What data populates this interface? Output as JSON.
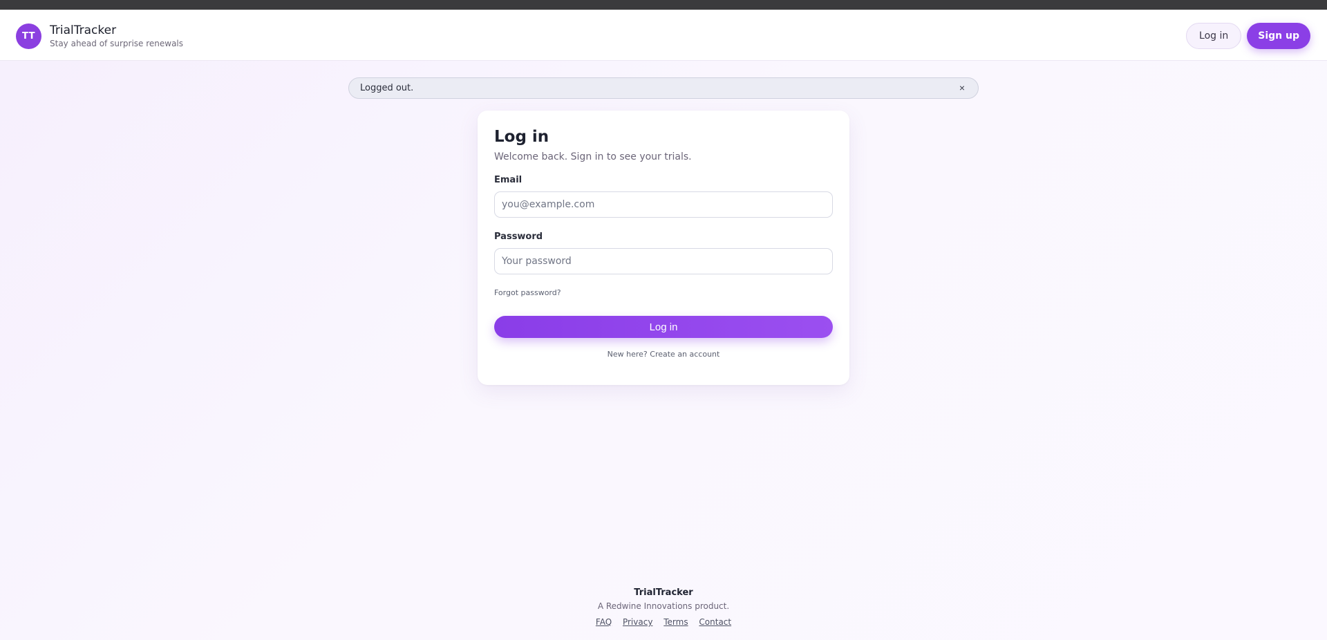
{
  "header": {
    "avatar_initials": "TT",
    "brand_name": "TrialTracker",
    "tagline": "Stay ahead of surprise renewals",
    "login_label": "Log in",
    "signup_label": "Sign up"
  },
  "alert": {
    "message": "Logged out.",
    "close_glyph": "×"
  },
  "login_card": {
    "title": "Log in",
    "subtitle": "Welcome back. Sign in to see your trials.",
    "email_label": "Email",
    "email_placeholder": "you@example.com",
    "email_value": "",
    "password_label": "Password",
    "password_placeholder": "Your password",
    "password_value": "",
    "forgot_label": "Forgot password?",
    "submit_label": "Log in",
    "new_here_text": "New here?",
    "create_account_label": "Create an account"
  },
  "footer": {
    "brand": "TrialTracker",
    "credit": "A Redwine Innovations product.",
    "links": [
      "FAQ",
      "Privacy",
      "Terms",
      "Contact"
    ]
  },
  "colors": {
    "accent": "#8b3fe6",
    "page_background": "#f8f3fe"
  },
  "icons": {
    "alert_close": "close-icon"
  }
}
